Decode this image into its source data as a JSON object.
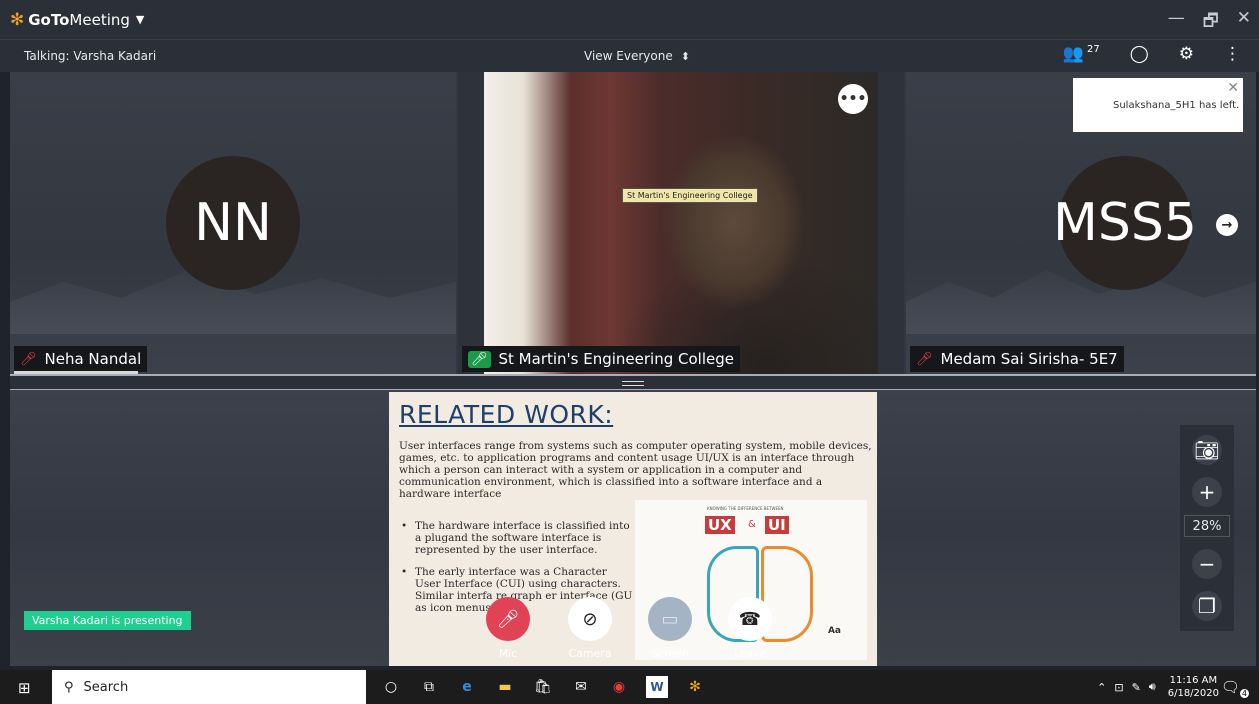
{
  "window": {
    "app_name_bold": "GoTo",
    "app_name_rest": "Meeting",
    "minimize": "—",
    "restore": "🗗",
    "close": "✕"
  },
  "toolbar": {
    "talking": "Talking: Varsha Kadari",
    "view": "View Everyone",
    "participants_count": "27"
  },
  "tiles": [
    {
      "initials": "NN",
      "name": "Neha Nandal",
      "mic": "muted"
    },
    {
      "name": "St Martin's Engineering College",
      "video_label": "St Martin's Engineering College",
      "mic": "active"
    },
    {
      "initials": "MSS5",
      "name": "Medam Sai Sirisha- 5E7",
      "mic": "muted"
    }
  ],
  "notification": {
    "text": "Sulakshana_5H1 has left."
  },
  "slide": {
    "title": "RELATED WORK:",
    "para": "User interfaces range from systems such as computer operating system, mobile devices, games, etc. to application programs and content usage UI/UX is an interface through which a person can interact with a system or application in a computer and communication environment, which is classified into a software interface and a hardware interface",
    "bullets": [
      "The hardware interface is classified into a plugand the software interface is represented by the user interface.",
      "The early interface was a Character User Interface (CUI) using characters. Similar interfa re graph er interface (GU as icon menus."
    ],
    "image": {
      "header": "KNOWING THE DIFFERENCE BETWEEN",
      "ux": "UX",
      "amp": "&",
      "ui": "UI",
      "aa": "Aa"
    }
  },
  "presenting": "Varsha Kadari is presenting",
  "zoom": {
    "percent": "28%"
  },
  "controls": {
    "mic": "Mic",
    "camera": "Camera",
    "screen": "Screen",
    "leave": "Leave"
  },
  "taskbar": {
    "search": "Search",
    "time": "11:16 AM",
    "date": "6/18/2020",
    "notifications": "4"
  },
  "colors": {
    "accent_orange": "#f7a21b",
    "mic_red": "#e14356",
    "presenting_green": "#1fcf8f",
    "talking_green": "#1a9b4a"
  }
}
